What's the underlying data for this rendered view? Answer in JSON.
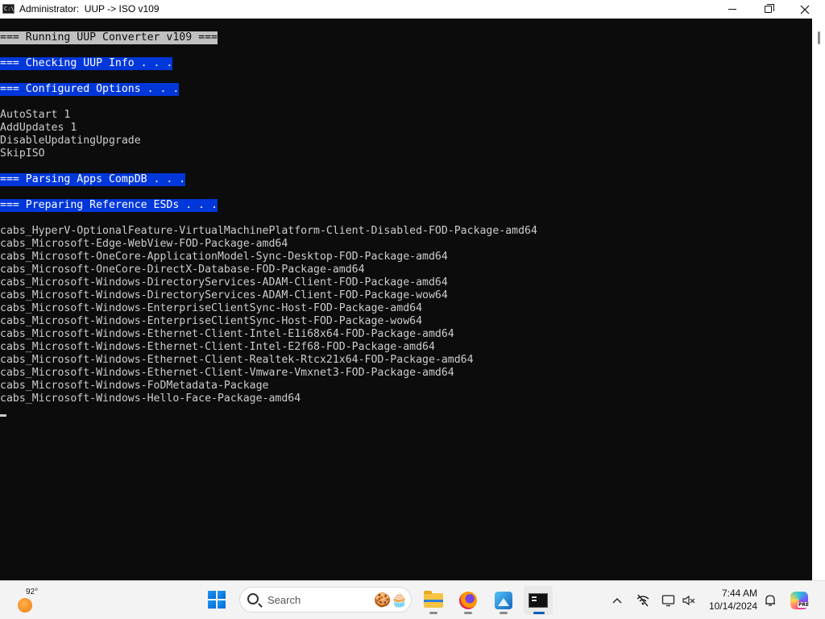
{
  "window": {
    "title": "Administrator:  UUP -> ISO v109",
    "icon_label": "C:\\",
    "controls": {
      "minimize": "minimize-icon",
      "maximize": "maximize-icon",
      "close": "✕"
    }
  },
  "console": {
    "lines": [
      {
        "text": "=== Running UUP Converter v109 ===",
        "highlight": "gray"
      },
      {
        "text": "",
        "highlight": "none"
      },
      {
        "text": "=== Checking UUP Info . . .",
        "highlight": "blue"
      },
      {
        "text": "",
        "highlight": "none"
      },
      {
        "text": "=== Configured Options . . .",
        "highlight": "blue"
      },
      {
        "text": "",
        "highlight": "none"
      },
      {
        "text": "AutoStart 1",
        "highlight": "none"
      },
      {
        "text": "AddUpdates 1",
        "highlight": "none"
      },
      {
        "text": "DisableUpdatingUpgrade",
        "highlight": "none"
      },
      {
        "text": "SkipISO",
        "highlight": "none"
      },
      {
        "text": "",
        "highlight": "none"
      },
      {
        "text": "=== Parsing Apps CompDB . . .",
        "highlight": "blue"
      },
      {
        "text": "",
        "highlight": "none"
      },
      {
        "text": "=== Preparing Reference ESDs . . .",
        "highlight": "blue"
      },
      {
        "text": "",
        "highlight": "none"
      },
      {
        "text": "cabs_HyperV-OptionalFeature-VirtualMachinePlatform-Client-Disabled-FOD-Package-amd64",
        "highlight": "none"
      },
      {
        "text": "cabs_Microsoft-Edge-WebView-FOD-Package-amd64",
        "highlight": "none"
      },
      {
        "text": "cabs_Microsoft-OneCore-ApplicationModel-Sync-Desktop-FOD-Package-amd64",
        "highlight": "none"
      },
      {
        "text": "cabs_Microsoft-OneCore-DirectX-Database-FOD-Package-amd64",
        "highlight": "none"
      },
      {
        "text": "cabs_Microsoft-Windows-DirectoryServices-ADAM-Client-FOD-Package-amd64",
        "highlight": "none"
      },
      {
        "text": "cabs_Microsoft-Windows-DirectoryServices-ADAM-Client-FOD-Package-wow64",
        "highlight": "none"
      },
      {
        "text": "cabs_Microsoft-Windows-EnterpriseClientSync-Host-FOD-Package-amd64",
        "highlight": "none"
      },
      {
        "text": "cabs_Microsoft-Windows-EnterpriseClientSync-Host-FOD-Package-wow64",
        "highlight": "none"
      },
      {
        "text": "cabs_Microsoft-Windows-Ethernet-Client-Intel-E1i68x64-FOD-Package-amd64",
        "highlight": "none"
      },
      {
        "text": "cabs_Microsoft-Windows-Ethernet-Client-Intel-E2f68-FOD-Package-amd64",
        "highlight": "none"
      },
      {
        "text": "cabs_Microsoft-Windows-Ethernet-Client-Realtek-Rtcx21x64-FOD-Package-amd64",
        "highlight": "none"
      },
      {
        "text": "cabs_Microsoft-Windows-Ethernet-Client-Vmware-Vmxnet3-FOD-Package-amd64",
        "highlight": "none"
      },
      {
        "text": "cabs_Microsoft-Windows-FoDMetadata-Package",
        "highlight": "none"
      },
      {
        "text": "cabs_Microsoft-Windows-Hello-Face-Package-amd64",
        "highlight": "none"
      }
    ],
    "colors": {
      "background": "#0c0c0c",
      "text": "#cccccc",
      "highlight_gray": "#c0c0c0",
      "highlight_blue": "#0037da"
    }
  },
  "taskbar": {
    "weather": {
      "temp": "92°",
      "icon": "sun-icon"
    },
    "search": {
      "placeholder": "Search",
      "decoration": "🍪🧁"
    },
    "apps": [
      {
        "name": "file-explorer",
        "icon": "folder-icon",
        "active": false
      },
      {
        "name": "firefox",
        "icon": "firefox-icon",
        "active": false
      },
      {
        "name": "photos",
        "icon": "photos-icon",
        "active": false
      },
      {
        "name": "terminal",
        "icon": "terminal-icon",
        "active": true
      }
    ],
    "tray": {
      "chevron": "^",
      "icons": [
        "network-off-icon",
        "display-icon",
        "volume-muted-icon"
      ],
      "time": "7:44 AM",
      "date": "10/14/2024",
      "notification_icon": "bell-icon",
      "copilot_badge": "PRE"
    }
  }
}
